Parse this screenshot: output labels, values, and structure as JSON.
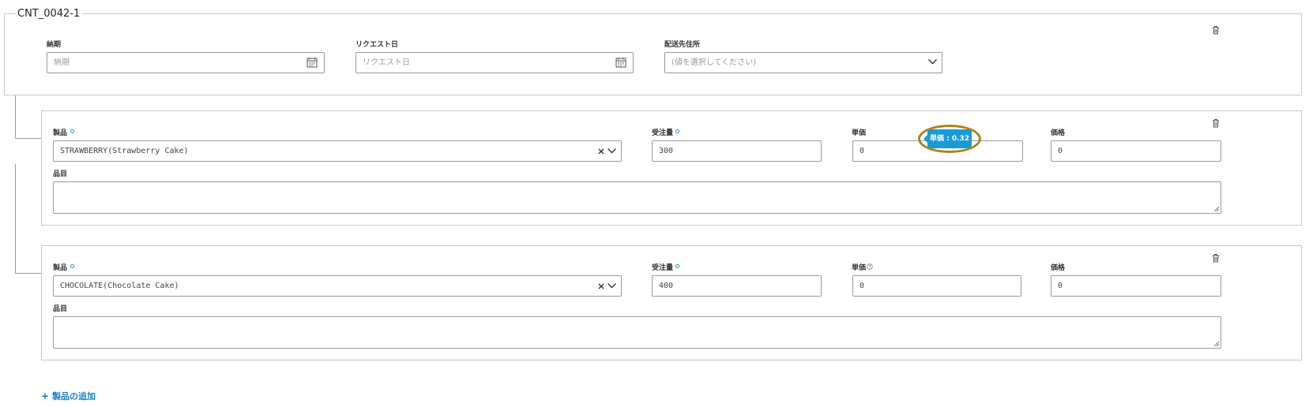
{
  "contract": {
    "title": "CNT_0042-1",
    "fields": {
      "due_date": {
        "label": "納期",
        "placeholder": "納期"
      },
      "request_date": {
        "label": "リクエスト日",
        "placeholder": "リクエスト日"
      },
      "ship_to": {
        "label": "配送先住所",
        "placeholder": "(値を選択してください)"
      }
    }
  },
  "labels": {
    "product": "製品",
    "quantity": "受注量",
    "unit_price": "単価",
    "price": "価格",
    "item": "品目"
  },
  "lines": [
    {
      "product": "STRAWBERRY(Strawberry Cake)",
      "quantity": "300",
      "unit_price": "0",
      "price": "0"
    },
    {
      "product": "CHOCOLATE(Chocolate Cake)",
      "quantity": "400",
      "unit_price": "0",
      "price": "0"
    }
  ],
  "tooltip": {
    "text": "単価 : 0.32"
  },
  "add_product": {
    "label": "製品の追加"
  },
  "icons": {
    "calendar": "calendar-icon",
    "trash": "trash-icon",
    "chevron": "chevron-down-icon",
    "clear": "clear-icon",
    "info": "info-icon"
  },
  "colors": {
    "accent": "#1a9bd8",
    "link": "#1a7ec4",
    "highlight": "#a8841e"
  }
}
